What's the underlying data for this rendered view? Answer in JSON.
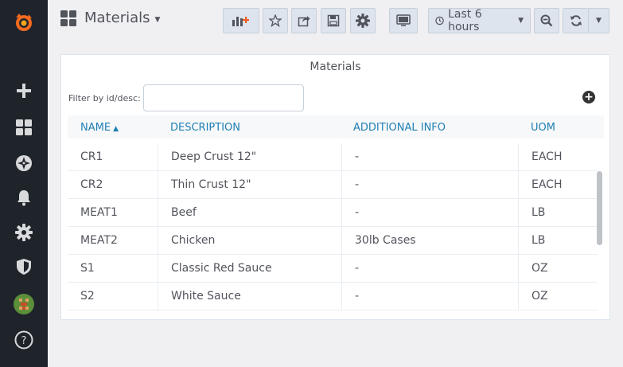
{
  "dashboard": {
    "title": "Materials",
    "time_range_label": "Last 6 hours"
  },
  "sidebar": {
    "icons": [
      "grafana-logo-icon",
      "plus-icon",
      "dashboards-icon",
      "explore-compass-icon",
      "alerting-bell-icon",
      "configuration-gear-icon",
      "server-admin-shield-icon",
      "user-avatar-icon",
      "help-icon"
    ]
  },
  "toolbar": {
    "icons": [
      "add-panel-icon",
      "star-icon",
      "share-icon",
      "save-icon",
      "settings-gear-icon",
      "tv-mode-icon",
      "clock-icon",
      "zoom-out-icon",
      "refresh-icon",
      "refresh-dropdown-icon"
    ]
  },
  "panel": {
    "title": "Materials",
    "filter_label": "Filter by id/desc:",
    "filter_value": "",
    "add_label": "+",
    "columns": [
      "NAME",
      "DESCRIPTION",
      "ADDITIONAL INFO",
      "UOM"
    ],
    "sort_indicator": "▲",
    "rows": [
      {
        "name": "CR1",
        "description": "Deep Crust 12\"",
        "info": "-",
        "uom": "EACH"
      },
      {
        "name": "CR2",
        "description": "Thin Crust 12\"",
        "info": "-",
        "uom": "EACH"
      },
      {
        "name": "MEAT1",
        "description": "Beef",
        "info": "-",
        "uom": "LB"
      },
      {
        "name": "MEAT2",
        "description": "Chicken",
        "info": "30lb Cases",
        "uom": "LB"
      },
      {
        "name": "S1",
        "description": "Classic Red Sauce",
        "info": "-",
        "uom": "OZ"
      },
      {
        "name": "S2",
        "description": "White Sauce",
        "info": "-",
        "uom": "OZ"
      }
    ]
  },
  "colors": {
    "sidebar_bg": "#1f242b",
    "page_bg": "#f0f0f3",
    "header_link": "#1f7fb4",
    "accent_orange": "#f15a24"
  }
}
